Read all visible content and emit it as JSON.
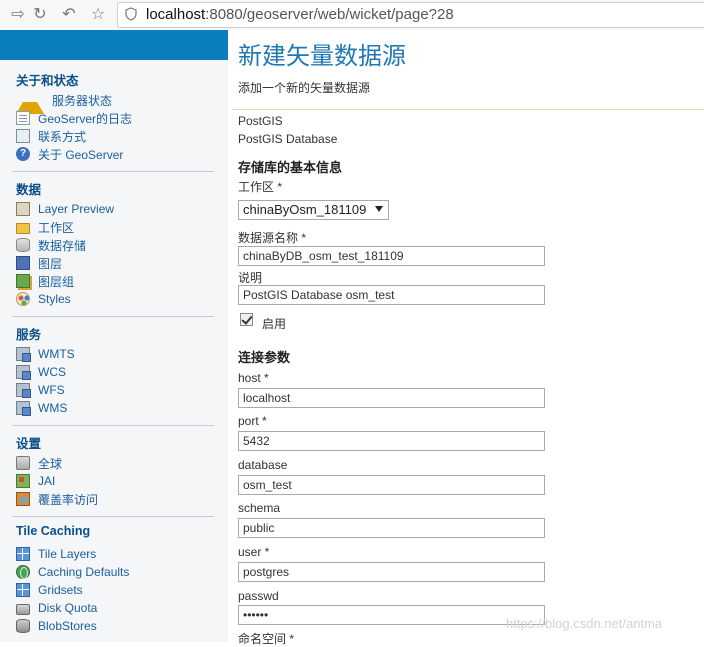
{
  "browser": {
    "url_host": "localhost",
    "url_rest": ":8080/geoserver/web/wicket/page?28"
  },
  "sidebar": {
    "about": {
      "title": "关于和状态",
      "items": [
        {
          "label": "服务器状态",
          "icon": "warning-icon"
        },
        {
          "label": "GeoServer的日志",
          "icon": "log-document-icon"
        },
        {
          "label": "联系方式",
          "icon": "contact-card-icon"
        },
        {
          "label": "关于 GeoServer",
          "icon": "help-icon"
        }
      ]
    },
    "data": {
      "title": "数据",
      "items": [
        {
          "label": "Layer Preview",
          "icon": "layer-preview-icon"
        },
        {
          "label": "工作区",
          "icon": "folder-icon"
        },
        {
          "label": "数据存储",
          "icon": "database-icon"
        },
        {
          "label": "图层",
          "icon": "layer-icon"
        },
        {
          "label": "图层组",
          "icon": "layer-group-icon"
        },
        {
          "label": "Styles",
          "icon": "styles-icon"
        }
      ]
    },
    "services": {
      "title": "服务",
      "items": [
        {
          "label": "WMTS",
          "icon": "service-icon"
        },
        {
          "label": "WCS",
          "icon": "service-icon"
        },
        {
          "label": "WFS",
          "icon": "service-icon"
        },
        {
          "label": "WMS",
          "icon": "service-icon"
        }
      ]
    },
    "settings": {
      "title": "设置",
      "items": [
        {
          "label": "全球",
          "icon": "global-settings-icon"
        },
        {
          "label": "JAI",
          "icon": "jai-icon"
        },
        {
          "label": "覆盖率访问",
          "icon": "coverage-access-icon"
        }
      ]
    },
    "tile_caching": {
      "title": "Tile Caching",
      "items": [
        {
          "label": "Tile Layers",
          "icon": "grid-icon"
        },
        {
          "label": "Caching Defaults",
          "icon": "globe-icon"
        },
        {
          "label": "Gridsets",
          "icon": "grid-icon"
        },
        {
          "label": "Disk Quota",
          "icon": "disk-icon"
        },
        {
          "label": "BlobStores",
          "icon": "blobstore-icon"
        }
      ]
    }
  },
  "main": {
    "title": "新建矢量数据源",
    "subtitle": "添加一个新的矢量数据源",
    "store_type": "PostGIS",
    "store_description": "PostGIS Database",
    "basic_section": "存储库的基本信息",
    "workspace_label": "工作区 *",
    "workspace_value": "chinaByOsm_181109",
    "datasource_name_label": "数据源名称 *",
    "datasource_name_value": "chinaByDB_osm_test_181109",
    "description_label": "说明",
    "description_value": "PostGIS Database osm_test",
    "enabled_label": "启用",
    "enabled": true,
    "connection_section": "连接参数",
    "host_label": "host *",
    "host_value": "localhost",
    "port_label": "port *",
    "port_value": "5432",
    "database_label": "database",
    "database_value": "osm_test",
    "schema_label": "schema",
    "schema_value": "public",
    "user_label": "user *",
    "user_value": "postgres",
    "passwd_label": "passwd",
    "passwd_value": "••••••",
    "namespace_label": "命名空间 *"
  },
  "watermark": "https://blog.csdn.net/antma",
  "colors": {
    "header_blue": "#0b7ebd",
    "title_blue": "#1f78b4",
    "link_blue": "#1a5f9e",
    "section_title": "#0b4f8a"
  }
}
